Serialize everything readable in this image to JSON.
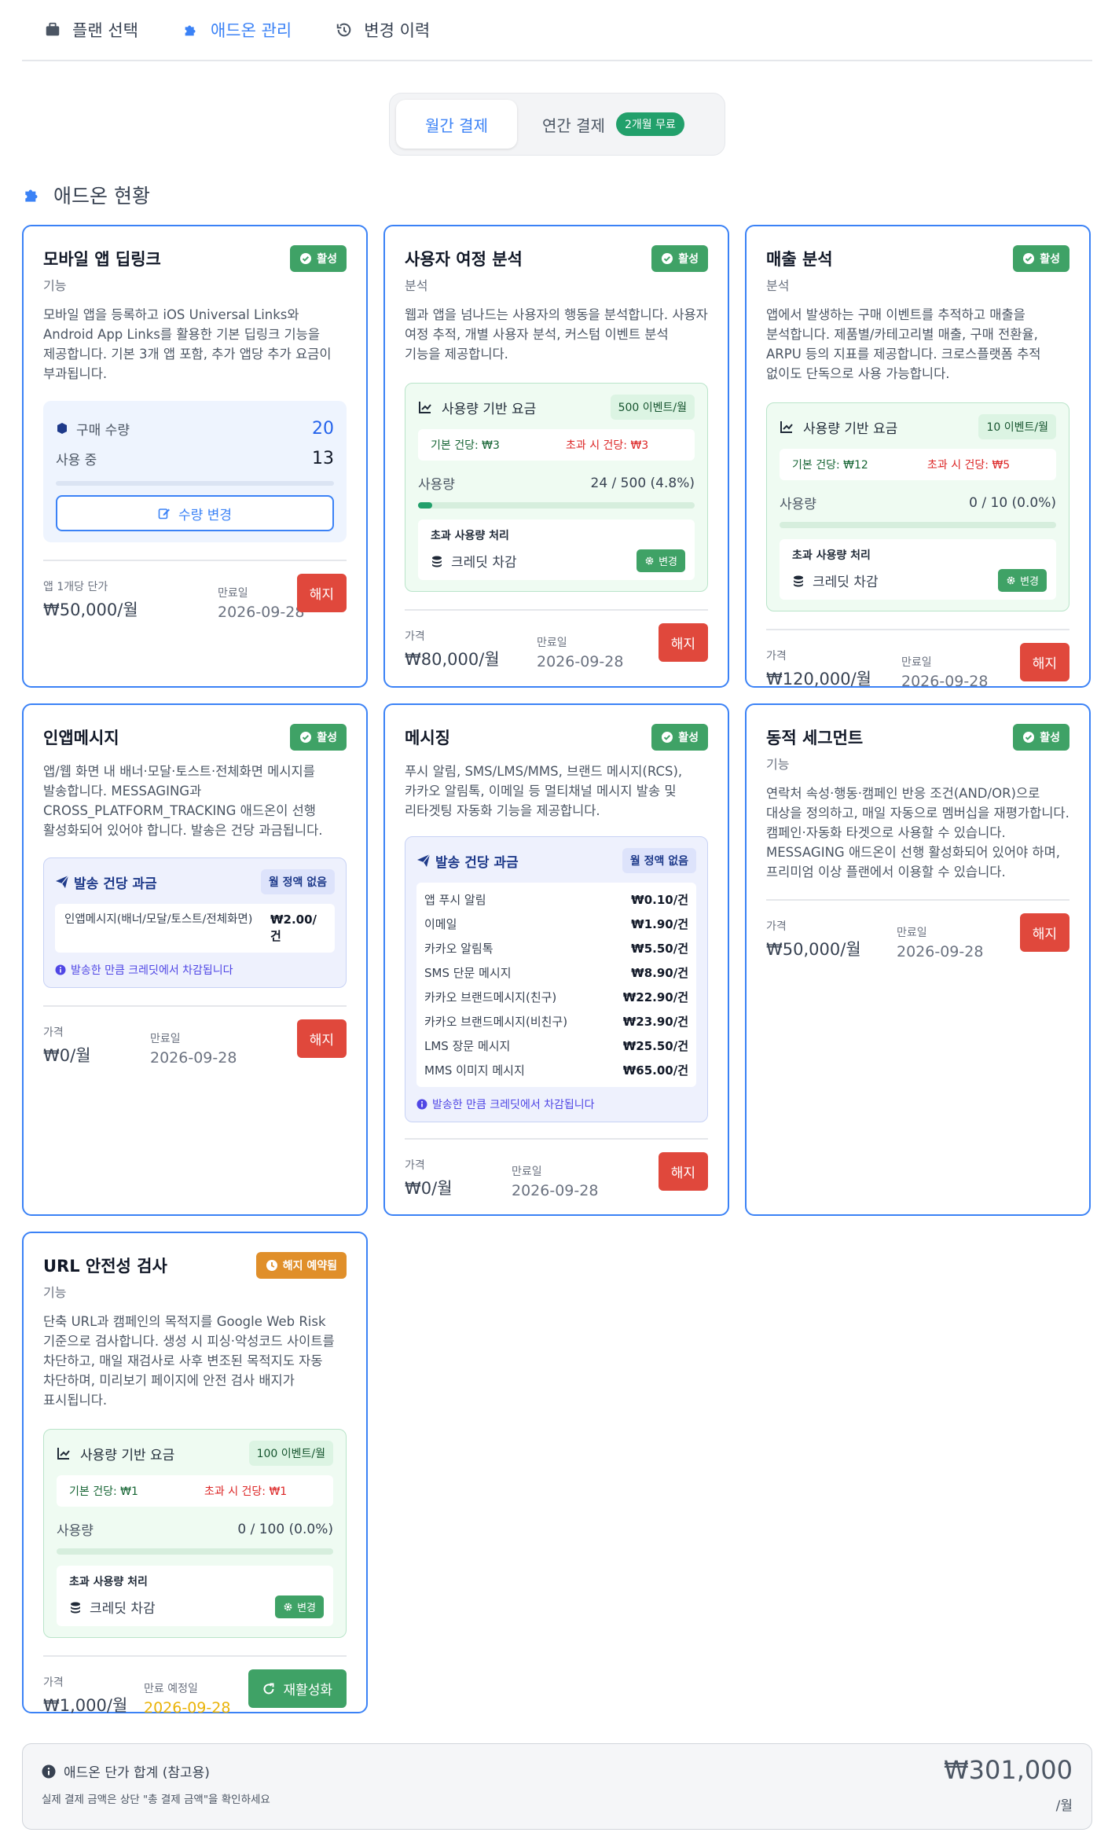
{
  "tabs": [
    {
      "label": "플랜 선택",
      "active": false
    },
    {
      "label": "애드온 관리",
      "active": true
    },
    {
      "label": "변경 이력",
      "active": false
    }
  ],
  "billing": {
    "monthly": "월간 결제",
    "yearly": "연간 결제",
    "yearly_badge": "2개월 무료",
    "selected": "monthly"
  },
  "section_title": "애드온 현황",
  "labels": {
    "status_active": "활성",
    "status_pending": "해지 예약됨",
    "cancel": "해지",
    "reactivate": "재활성화",
    "price": "가격",
    "expiry": "만료일",
    "expiry_planned": "만료 예정일",
    "per_app_price": "앱 1개당 단가",
    "purchase_qty": "구매 수량",
    "in_use": "사용 중",
    "change_qty": "수량 변경",
    "usage_pricing": "사용량 기반 요금",
    "usage": "사용량",
    "overage_handling": "초과 사용량 처리",
    "credit_deduct": "크레딧 차감",
    "change": "변경",
    "send_pricing": "발송 건당 과금",
    "no_flat": "월 정액 없음",
    "send_note": "발송한 만큼 크레딧에서 차감됩니다"
  },
  "cards": {
    "deeplink": {
      "title": "모바일 앱 딥링크",
      "category": "기능",
      "desc": "모바일 앱을 등록하고 iOS Universal Links와 Android App Links를 활용한 기본 딥링크 기능을 제공합니다. 기본 3개 앱 포함, 추가 앱당 추가 요금이 부과됩니다.",
      "purchase_qty": "20",
      "in_use": "13",
      "price": "₩50,000/월",
      "expiry": "2026-09-28"
    },
    "journey": {
      "title": "사용자 여정 분석",
      "category": "분석",
      "desc": "웹과 앱을 넘나드는 사용자의 행동을 분석합니다. 사용자 여정 추적, 개별 사용자 분석, 커스텀 이벤트 분석 기능을 제공합니다.",
      "quota": "500 이벤트/월",
      "base_unit": "기본 건당: ₩3",
      "over_unit": "초과 시 건당: ₩3",
      "usage": "24 / 500 (4.8%)",
      "usage_fraction": 0.048,
      "price": "₩80,000/월",
      "expiry": "2026-09-28"
    },
    "revenue": {
      "title": "매출 분석",
      "category": "분석",
      "desc": "앱에서 발생하는 구매 이벤트를 추적하고 매출을 분석합니다. 제품별/카테고리별 매출, 구매 전환율, ARPU 등의 지표를 제공합니다. 크로스플랫폼 추적 없이도 단독으로 사용 가능합니다.",
      "quota": "10 이벤트/월",
      "base_unit": "기본 건당: ₩12",
      "over_unit": "초과 시 건당: ₩5",
      "usage": "0 / 10 (0.0%)",
      "usage_fraction": 0,
      "price": "₩120,000/월",
      "expiry": "2026-09-28"
    },
    "inapp": {
      "title": "인앱메시지",
      "desc": "앱/웹 화면 내 배너·모달·토스트·전체화면 메시지를 발송합니다. MESSAGING과 CROSS_PLATFORM_TRACKING 애드온이 선행 활성화되어 있어야 합니다. 발송은 건당 과금됩니다.",
      "items": [
        {
          "name": "인앱메시지(배너/모달/토스트/전체화면)",
          "price": "₩2.00/건"
        }
      ],
      "price": "₩0/월",
      "expiry": "2026-09-28"
    },
    "messaging": {
      "title": "메시징",
      "desc": "푸시 알림, SMS/LMS/MMS, 브랜드 메시지(RCS), 카카오 알림톡, 이메일 등 멀티채널 메시지 발송 및 리타겟팅 자동화 기능을 제공합니다.",
      "items": [
        {
          "name": "앱 푸시 알림",
          "price": "₩0.10/건"
        },
        {
          "name": "이메일",
          "price": "₩1.90/건"
        },
        {
          "name": "카카오 알림톡",
          "price": "₩5.50/건"
        },
        {
          "name": "SMS 단문 메시지",
          "price": "₩8.90/건"
        },
        {
          "name": "카카오 브랜드메시지(친구)",
          "price": "₩22.90/건"
        },
        {
          "name": "카카오 브랜드메시지(비친구)",
          "price": "₩23.90/건"
        },
        {
          "name": "LMS 장문 메시지",
          "price": "₩25.50/건"
        },
        {
          "name": "MMS 이미지 메시지",
          "price": "₩65.00/건"
        }
      ],
      "price": "₩0/월",
      "expiry": "2026-09-28"
    },
    "segment": {
      "title": "동적 세그먼트",
      "category": "기능",
      "desc": "연락처 속성·행동·캠페인 반응 조건(AND/OR)으로 대상을 정의하고, 매일 자동으로 멤버십을 재평가합니다. 캠페인·자동화 타겟으로 사용할 수 있습니다. MESSAGING 애드온이 선행 활성화되어 있어야 하며, 프리미엄 이상 플랜에서 이용할 수 있습니다.",
      "price": "₩50,000/월",
      "expiry": "2026-09-28"
    },
    "urlsafety": {
      "title": "URL 안전성 검사",
      "category": "기능",
      "desc": "단축 URL과 캠페인의 목적지를 Google Web Risk 기준으로 검사합니다. 생성 시 피싱·악성코드 사이트를 차단하고, 매일 재검사로 사후 변조된 목적지도 자동 차단하며, 미리보기 페이지에 안전 검사 배지가 표시됩니다.",
      "quota": "100 이벤트/월",
      "base_unit": "기본 건당: ₩1",
      "over_unit": "초과 시 건당: ₩1",
      "usage": "0 / 100 (0.0%)",
      "usage_fraction": 0,
      "price": "₩1,000/월",
      "expiry": "2026-09-28"
    }
  },
  "total": {
    "title": "애드온 단가 합계 (참고용)",
    "note": "실제 결제 금액은 상단 \"총 결제 금액\"을 확인하세요",
    "amount": "₩301,000",
    "per": "/월"
  },
  "colors": {
    "accent": "#3b82f6",
    "active_badge": "#3fa266",
    "pending_badge": "#e08f2a",
    "cancel": "#e0483c"
  }
}
